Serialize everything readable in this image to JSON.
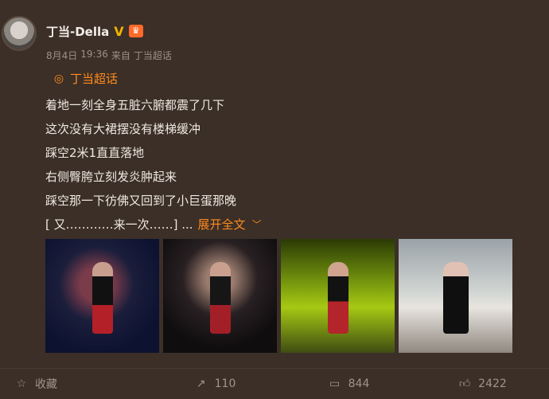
{
  "post": {
    "author": {
      "name": "丁当-Della"
    },
    "meta": {
      "date": "8月4日",
      "time": "19:36",
      "source_prefix": "来自",
      "source": "丁当超话"
    },
    "topic": {
      "label": "丁当超话"
    },
    "lines": [
      "着地一刻全身五脏六腑都震了几下",
      "这次没有大裙摆没有楼梯缓冲",
      "踩空2米1直直落地",
      "右侧臀胯立刻发炎肿起来",
      "踩空那一下彷佛又回到了小巨蛋那晚"
    ],
    "truncated_line": "[ 又…………来一次……] ...",
    "expand_label": "展开全文",
    "photos": [
      {
        "alt": ""
      },
      {
        "alt": ""
      },
      {
        "alt": ""
      },
      {
        "alt": ""
      }
    ],
    "actions": {
      "favorite": "收藏",
      "repost_count": "110",
      "comment_count": "844",
      "like_count": "2422"
    }
  }
}
